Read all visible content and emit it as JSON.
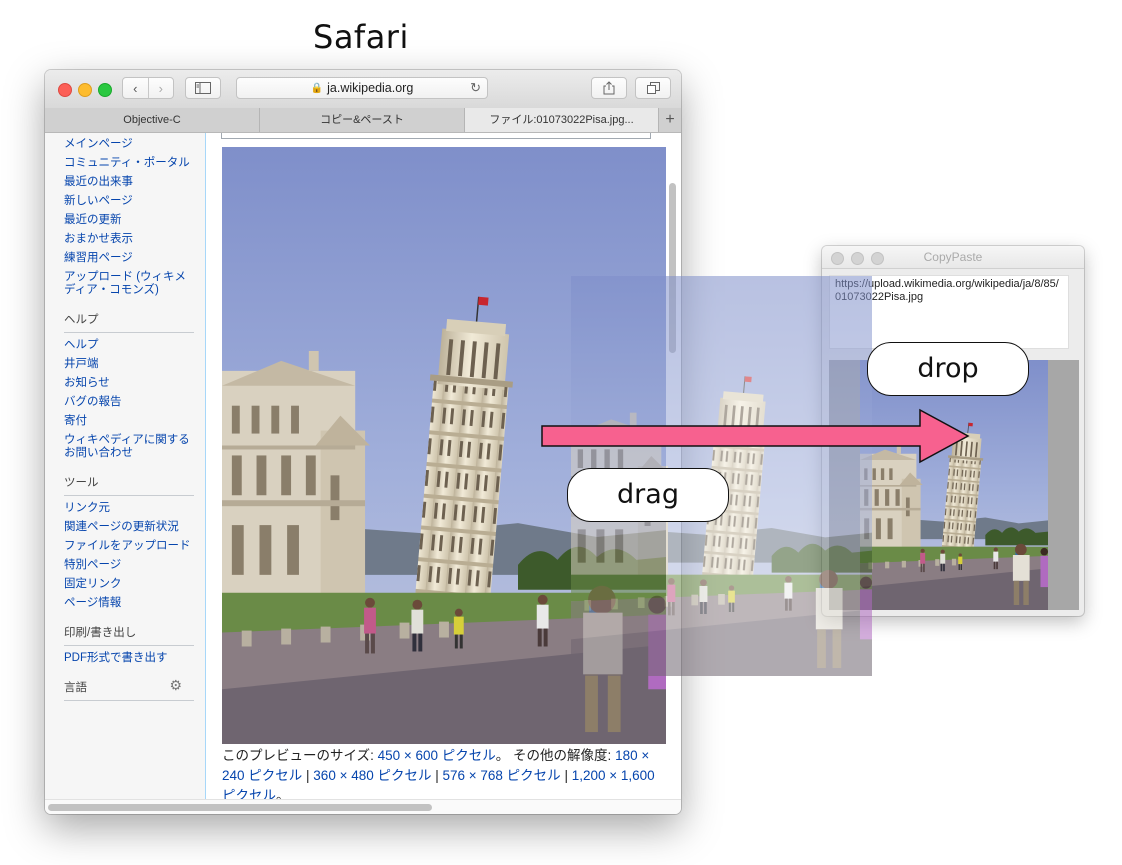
{
  "caption": "Safari",
  "safari": {
    "address": "ja.wikipedia.org",
    "tabs": [
      "Objective-C",
      "コピー&ペースト",
      "ファイル:01073022Pisa.jpg..."
    ],
    "sidebar": {
      "group1": [
        "メインページ",
        "コミュニティ・ポータル",
        "最近の出来事",
        "新しいページ",
        "最近の更新",
        "おまかせ表示",
        "練習用ページ",
        "アップロード (ウィキメディア・コモンズ)"
      ],
      "help_heading": "ヘルプ",
      "help_links": [
        "ヘルプ",
        "井戸端",
        "お知らせ",
        "バグの報告",
        "寄付",
        "ウィキペディアに関するお問い合わせ"
      ],
      "tools_heading": "ツール",
      "tools_links": [
        "リンク元",
        "関連ページの更新状況",
        "ファイルをアップロード",
        "特別ページ",
        "固定リンク",
        "ページ情報"
      ],
      "print_heading": "印刷/書き出し",
      "print_links": [
        "PDF形式で書き出す"
      ],
      "lang_heading": "言語"
    },
    "preview": {
      "prefix": "このプレビューのサイズ: ",
      "size": "450 × 600 ピクセル",
      "mid": "。 その他の解像度: ",
      "res1": "180 × 240 ピクセル",
      "sep": " | ",
      "res2": "360 × 480 ピクセル",
      "res3": "576 × 768 ピクセル",
      "res4": "1,200 × 1,600 ピクセル",
      "suffix": "。"
    }
  },
  "copypaste": {
    "title": "CopyPaste",
    "url": "https://upload.wikimedia.org/wikipedia/ja/8/85/01073022Pisa.jpg"
  },
  "annotations": {
    "drag": "drag",
    "drop": "drop",
    "arrow_color": "#f7618f"
  },
  "icons": {
    "back": "chevron-left-icon",
    "forward": "chevron-right-icon",
    "sidebar": "sidebar-icon",
    "lock": "lock-icon",
    "reload": "reload-icon",
    "share": "share-icon",
    "tabs": "tabs-icon",
    "gear": "gear-icon",
    "add_tab": "plus-icon"
  }
}
